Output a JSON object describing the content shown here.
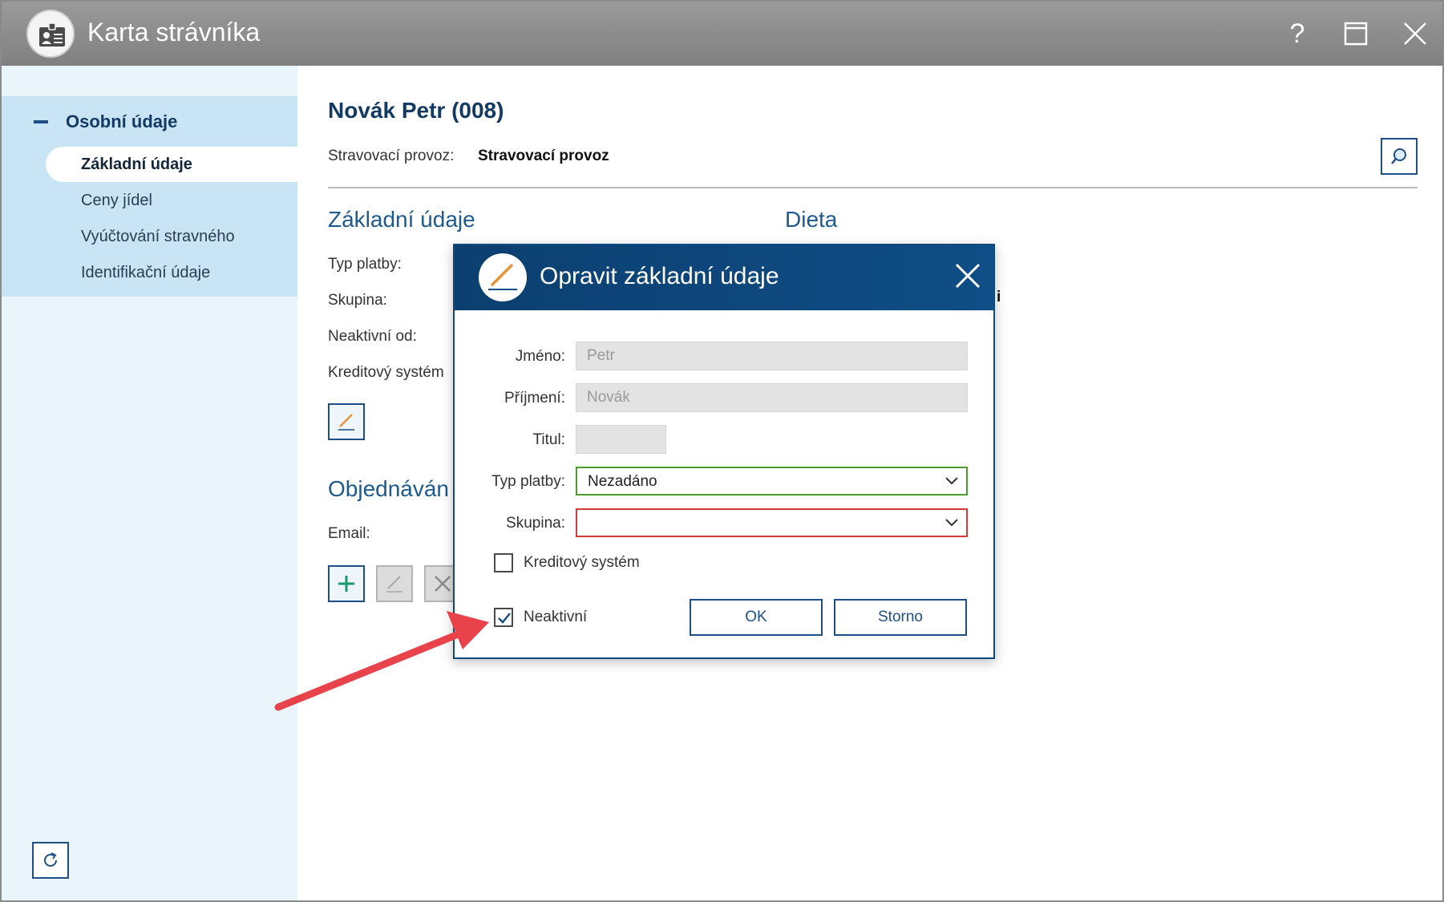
{
  "window": {
    "title": "Karta strávníka",
    "controls": {
      "help": "?",
      "maximize": "maximize-icon",
      "close": "close-icon"
    }
  },
  "sidebar": {
    "group_label": "Osobní údaje",
    "items": [
      {
        "label": "Základní údaje",
        "active": true
      },
      {
        "label": "Ceny jídel",
        "active": false
      },
      {
        "label": "Vyúčtování stravného",
        "active": false
      },
      {
        "label": "Identifikační údaje",
        "active": false
      }
    ]
  },
  "main": {
    "person_name": "Novák Petr (008)",
    "provoz_label": "Stravovací provoz:",
    "provoz_value": "Stravovací provoz",
    "sections": {
      "basic": "Základní údaje",
      "diet": "Dieta",
      "orders": "Objednáván"
    },
    "fields": {
      "typ_platby": "Typ platby:",
      "skupina": "Skupina:",
      "neaktivni_od": "Neaktivní od:",
      "kreditovy": "Kreditový systém",
      "email": "Email:"
    },
    "partial_value": "i"
  },
  "dialog": {
    "title": "Opravit základní údaje",
    "fields": {
      "jmeno_label": "Jméno:",
      "jmeno_value": "Petr",
      "prijmeni_label": "Příjmení:",
      "prijmeni_value": "Novák",
      "titul_label": "Titul:",
      "titul_value": "",
      "typ_platby_label": "Typ platby:",
      "typ_platby_value": "Nezadáno",
      "skupina_label": "Skupina:",
      "skupina_value": ""
    },
    "checkboxes": {
      "kreditovy_label": "Kreditový systém",
      "kreditovy_checked": false,
      "neaktivni_label": "Neaktivní",
      "neaktivni_checked": true
    },
    "buttons": {
      "ok": "OK",
      "cancel": "Storno"
    }
  },
  "colors": {
    "accent": "#0f4e86",
    "valid_border": "#4a9a2c",
    "error_border": "#d03a3a",
    "annotation_arrow": "#e8434a"
  }
}
